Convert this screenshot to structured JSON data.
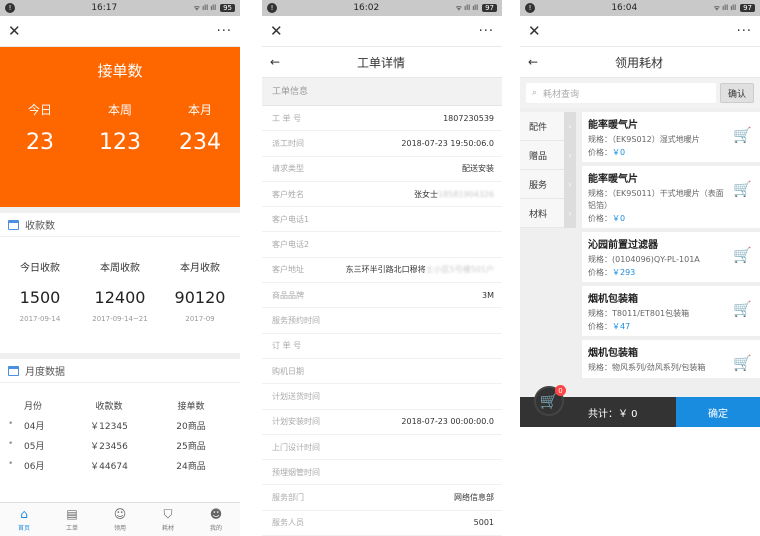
{
  "panel1": {
    "status": {
      "alert": "!",
      "time": "16:17",
      "signal": "ᯤ ıll ıll",
      "battery": "95"
    },
    "close": "✕",
    "more": "···",
    "hero": {
      "title": "接单数",
      "cols": [
        {
          "label": "今日",
          "value": "23"
        },
        {
          "label": "本周",
          "value": "123"
        },
        {
          "label": "本月",
          "value": "234"
        }
      ]
    },
    "payments": {
      "heading": "收款数",
      "cols": [
        {
          "label": "今日收款",
          "value": "1500",
          "date": "2017-09-14"
        },
        {
          "label": "本周收款",
          "value": "12400",
          "date": "2017-09-14~21"
        },
        {
          "label": "本月收款",
          "value": "90120",
          "date": "2017-09"
        }
      ]
    },
    "monthly": {
      "heading": "月度数据",
      "headers": [
        "月份",
        "收款数",
        "接单数"
      ],
      "rows": [
        [
          "04月",
          "￥12345",
          "20商品"
        ],
        [
          "05月",
          "￥23456",
          "25商品"
        ],
        [
          "06月",
          "￥44674",
          "24商品"
        ]
      ]
    },
    "nav": [
      {
        "label": "首页",
        "icon": "home-icon"
      },
      {
        "label": "工单",
        "icon": "document-icon"
      },
      {
        "label": "领用",
        "icon": "user-icon"
      },
      {
        "label": "耗材",
        "icon": "bag-icon"
      },
      {
        "label": "我的",
        "icon": "profile-icon"
      }
    ]
  },
  "panel2": {
    "status": {
      "alert": "!",
      "time": "16:02",
      "signal": "ᯤ ıll ıll",
      "battery": "97"
    },
    "close": "✕",
    "more": "···",
    "back": "←",
    "title": "工单详情",
    "section": "工单信息",
    "fields": [
      {
        "k": "工 单 号",
        "v": "1807230539"
      },
      {
        "k": "派工时间",
        "v": "2018-07-23 19:50:06.0"
      },
      {
        "k": "请求类型",
        "v": "配送安装"
      },
      {
        "k": "客户姓名",
        "v": "张女士",
        "blur": "18581904326"
      },
      {
        "k": "客户电话1",
        "v": ""
      },
      {
        "k": "客户电话2",
        "v": ""
      },
      {
        "k": "客户地址",
        "v": "东三环半引路北口穆将",
        "blur": "土小区5号楼501户"
      },
      {
        "k": "商品品牌",
        "v": "3M"
      },
      {
        "k": "服务预约时间",
        "v": ""
      },
      {
        "k": "订 单 号",
        "v": ""
      },
      {
        "k": "购机日期",
        "v": ""
      },
      {
        "k": "计划送货时间",
        "v": ""
      },
      {
        "k": "计划安装时间",
        "v": "2018-07-23 00:00:00.0"
      },
      {
        "k": "上门设计时间",
        "v": ""
      },
      {
        "k": "预埋烟管时间",
        "v": ""
      },
      {
        "k": "服务部门",
        "v": "网络信息部"
      },
      {
        "k": "服务人员",
        "v": "5001"
      }
    ]
  },
  "panel3": {
    "status": {
      "alert": "!",
      "time": "16:04",
      "signal": "ᯤ ıll ıll",
      "battery": "97"
    },
    "close": "✕",
    "more": "···",
    "back": "←",
    "title": "领用耗材",
    "search_placeholder": "耗材查询",
    "confirm": "确认",
    "categories": [
      "配件",
      "赠品",
      "服务",
      "材料"
    ],
    "products": [
      {
        "name": "能率暖气片",
        "spec": "规格：（EK9S012）湿式地暖片",
        "price_label": "价格：",
        "price": "￥0"
      },
      {
        "name": "能率暖气片",
        "spec": "规格：（EK9S011）干式地暖片（表面铝箔）",
        "price_label": "价格：",
        "price": "￥0"
      },
      {
        "name": "沁园前置过滤器",
        "spec": "规格：(0104096)QY-PL-101A",
        "price_label": "价格：",
        "price": "￥293"
      },
      {
        "name": "烟机包装箱",
        "spec": "规格：T8011/ET801包装箱",
        "price_label": "价格：",
        "price": "￥47"
      },
      {
        "name": "烟机包装箱",
        "spec": "规格：物风系列/劲风系列/包装箱",
        "price_label": "价格：",
        "price": ""
      }
    ],
    "cart_badge": "0",
    "total": "共计：￥ 0",
    "submit": "确定"
  }
}
